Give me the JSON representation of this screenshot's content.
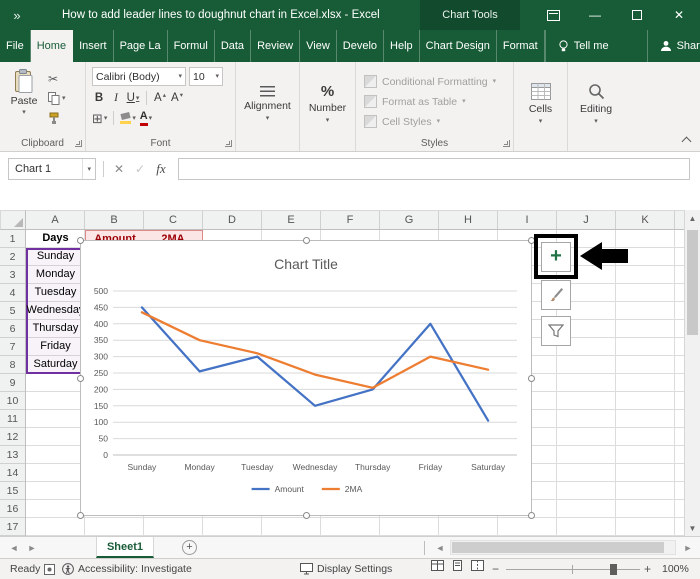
{
  "titlebar": {
    "overflow_chevron": "»",
    "title": "How to add leader lines to doughnut chart in Excel.xlsx  -  Excel",
    "context_label": "Chart Tools"
  },
  "ribbon_tabs": {
    "items": [
      {
        "label": "File",
        "active": false
      },
      {
        "label": "Home",
        "active": true
      },
      {
        "label": "Insert",
        "active": false
      },
      {
        "label": "Page La",
        "active": false
      },
      {
        "label": "Formul",
        "active": false
      },
      {
        "label": "Data",
        "active": false
      },
      {
        "label": "Review",
        "active": false
      },
      {
        "label": "View",
        "active": false
      },
      {
        "label": "Develo",
        "active": false
      },
      {
        "label": "Help",
        "active": false
      },
      {
        "label": "Chart Design",
        "active": false
      },
      {
        "label": "Format",
        "active": false
      }
    ],
    "tell_me": "Tell me",
    "share": "Share"
  },
  "ribbon": {
    "paste": "Paste",
    "clipboard_label": "Clipboard",
    "font_name": "Calibri (Body)",
    "font_size": "10",
    "bold": "B",
    "italic": "I",
    "underline": "U",
    "font_label": "Font",
    "alignment_label": "Alignment",
    "percent": "%",
    "number_label": "Number",
    "styles": [
      "Conditional Formatting",
      "Format as Table",
      "Cell Styles"
    ],
    "styles_label": "Styles",
    "cells_label": "Cells",
    "editing_label": "Editing"
  },
  "formula_bar": {
    "name_box": "Chart 1",
    "fx": "fx",
    "formula": ""
  },
  "grid": {
    "columns": [
      "A",
      "B",
      "C",
      "D",
      "E",
      "F",
      "G",
      "H",
      "I",
      "J",
      "K"
    ],
    "row_count": 17,
    "header_cells": {
      "A1": "Days",
      "B1": "Amount",
      "C1": "2MA"
    },
    "days": [
      "Sunday",
      "Monday",
      "Tuesday",
      "Wednesday",
      "Thursday",
      "Friday",
      "Saturday"
    ]
  },
  "chart_data": {
    "type": "line",
    "title": "Chart Title",
    "categories": [
      "Sunday",
      "Monday",
      "Tuesday",
      "Wednesday",
      "Thursday",
      "Friday",
      "Saturday"
    ],
    "series": [
      {
        "name": "Amount",
        "color": "#4472C4",
        "values": [
          450,
          255,
          300,
          150,
          200,
          400,
          105
        ]
      },
      {
        "name": "2MA",
        "color": "#ED7D31",
        "values": [
          435,
          350,
          310,
          245,
          205,
          300,
          260
        ]
      }
    ],
    "ylim": [
      0,
      500
    ],
    "ytick_step": 50,
    "grid": true,
    "legend_position": "bottom"
  },
  "sheet_bar": {
    "sheet_name": "Sheet1"
  },
  "status_bar": {
    "ready": "Ready",
    "accessibility": "Accessibility: Investigate",
    "display_settings": "Display Settings",
    "zoom": "100%"
  }
}
